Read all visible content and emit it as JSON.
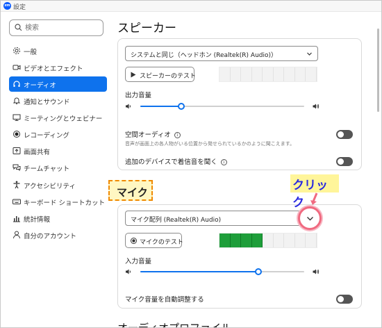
{
  "window": {
    "title": "設定",
    "app_icon_text": "zm"
  },
  "search": {
    "placeholder": "検索"
  },
  "sidebar": {
    "items": [
      {
        "label": "一般",
        "icon": "gear-icon"
      },
      {
        "label": "ビデオとエフェクト",
        "icon": "video-camera-icon"
      },
      {
        "label": "オーディオ",
        "icon": "headphones-icon",
        "active": true
      },
      {
        "label": "通知とサウンド",
        "icon": "bell-icon"
      },
      {
        "label": "ミーティングとウェビナー",
        "icon": "monitor-icon"
      },
      {
        "label": "レコーディング",
        "icon": "record-icon"
      },
      {
        "label": "画面共有",
        "icon": "share-screen-icon"
      },
      {
        "label": "チームチャット",
        "icon": "chat-icon"
      },
      {
        "label": "アクセシビリティ",
        "icon": "accessibility-icon"
      },
      {
        "label": "キーボード ショートカット",
        "icon": "keyboard-icon"
      },
      {
        "label": "統計情報",
        "icon": "chart-icon"
      },
      {
        "label": "自分のアカウント",
        "icon": "user-icon"
      }
    ]
  },
  "speaker": {
    "heading": "スピーカー",
    "device": "システムと同じ（ヘッドホン (Realtek(R) Audio)）",
    "test_button": "スピーカーのテスト",
    "meter_level": 0,
    "output_volume_label": "出力音量",
    "output_volume": 0.25,
    "spatial_audio_label": "空間オーディオ",
    "spatial_audio_desc": "音声が画面上の各人物がいる位置から発せられているかのように聞こえます。",
    "spatial_audio_on": false,
    "ring_additional_label": "追加のデバイスで着信音を聞く",
    "ring_additional_on": false
  },
  "mic": {
    "heading": "マイク",
    "device": "マイク配列 (Realtek(R) Audio)",
    "test_button": "マイクのテスト",
    "meter_level": 4,
    "meter_segments": 9,
    "input_volume_label": "入力音量",
    "input_volume": 0.72,
    "auto_adjust_label": "マイク音量を自動調整する",
    "auto_adjust_on": false
  },
  "annotation": {
    "click_label": "クリック"
  },
  "next_section_peek": "オーディオプロファイル",
  "colors": {
    "accent": "#0e72ed",
    "meter_on": "#1e9e3a",
    "callout_border": "#f08a00",
    "click_text": "#2a2ae0"
  }
}
